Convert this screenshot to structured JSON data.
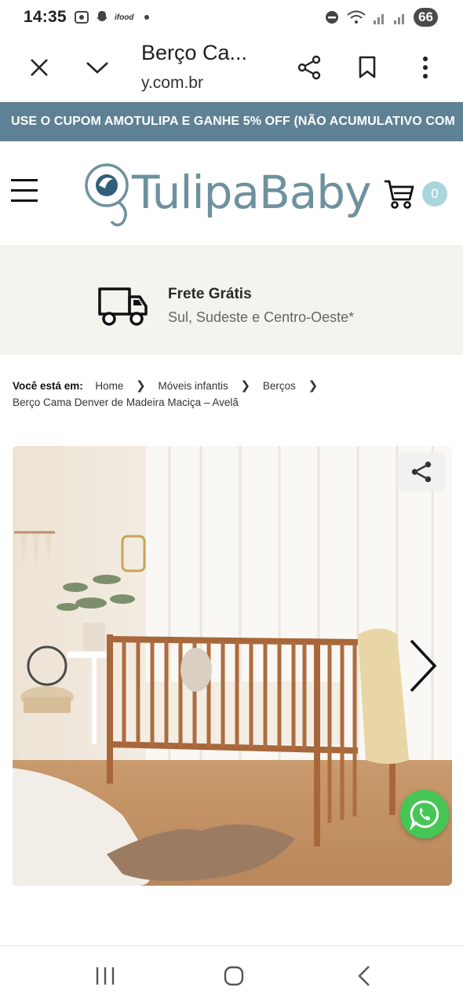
{
  "status_bar": {
    "time": "14:35",
    "notif_text": "ifood",
    "battery": "66"
  },
  "browser": {
    "title": "Berço Ca...",
    "url": "y.com.br"
  },
  "promo": {
    "text": "USE O CUPOM AMOTULIPA E GANHE 5% OFF (NÃO ACUMULATIVO COM"
  },
  "header": {
    "logo_text": "TulipaBaby",
    "cart_count": "0"
  },
  "shipping": {
    "title": "Frete Grátis",
    "subtitle": "Sul, Sudeste e Centro-Oeste*"
  },
  "breadcrumb": {
    "label": "Você está em:",
    "items": [
      "Home",
      "Móveis infantis",
      "Berços"
    ],
    "current": "Berço Cama Denver de Madeira Maciça – Avelã"
  },
  "colors": {
    "promo_bg": "#5f8195",
    "brand": "#6e919e",
    "cart_badge": "#a9d6dc",
    "shipping_bg": "#f5f3ee",
    "whatsapp": "#45c655"
  }
}
